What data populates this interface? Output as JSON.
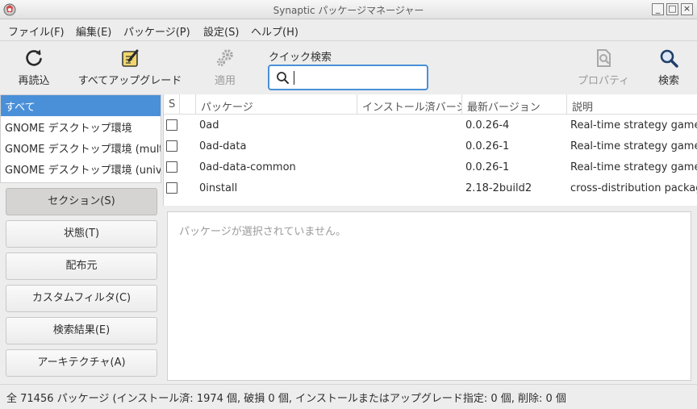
{
  "window": {
    "title": "Synaptic パッケージマネージャー",
    "controls": [
      "_",
      "□",
      "×"
    ]
  },
  "menubar": [
    "ファイル(F)",
    "編集(E)",
    "パッケージ(P)",
    "設定(S)",
    "ヘルプ(H)"
  ],
  "toolbar": {
    "reload_label": "再読込",
    "upgrade_all_label": "すべてアップグレード",
    "apply_label": "適用",
    "quick_search_label": "クイック検索",
    "quick_search_value": "",
    "properties_label": "プロパティ",
    "search_label": "検索"
  },
  "filters": {
    "items": [
      "すべて",
      "GNOME デスクトップ環境",
      "GNOME デスクトップ環境 (multiverse)",
      "GNOME デスクトップ環境 (universe)"
    ],
    "selected": "すべて"
  },
  "side_buttons": [
    "セクション(S)",
    "状態(T)",
    "配布元",
    "カスタムフィルタ(C)",
    "検索結果(E)",
    "アーキテクチャ(A)"
  ],
  "table": {
    "columns": [
      "S",
      "",
      "パッケージ",
      "インストール済バージョン",
      "最新バージョン",
      "説明"
    ],
    "rows": [
      {
        "package": "0ad",
        "installed": "",
        "latest": "0.0.26-4",
        "description": "Real-time strategy game of ancient warfare"
      },
      {
        "package": "0ad-data",
        "installed": "",
        "latest": "0.0.26-1",
        "description": "Real-time strategy game of ancient warfare (data files)"
      },
      {
        "package": "0ad-data-common",
        "installed": "",
        "latest": "0.0.26-1",
        "description": "Real-time strategy game of ancient warfare (common data files)"
      },
      {
        "package": "0install",
        "installed": "",
        "latest": "2.18-2build2",
        "description": "cross-distribution packaging system"
      }
    ]
  },
  "details": {
    "empty_message": "パッケージが選択されていません。"
  },
  "status": {
    "text": "全 71456 パッケージ (インストール済: 1974 個, 破損 0 個, インストールまたはアップグレード指定: 0 個, 削除: 0 個"
  },
  "colors": {
    "accent": "#4a90d9",
    "selected_text": "#ffffff"
  }
}
